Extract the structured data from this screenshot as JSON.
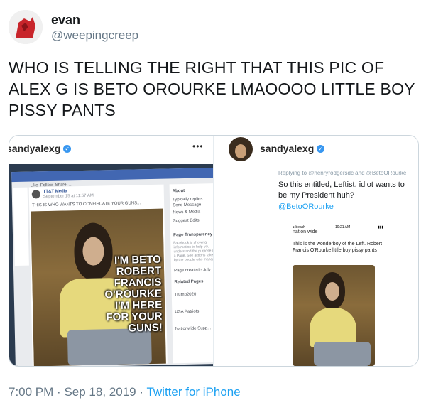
{
  "tweet": {
    "author_name": "evan",
    "author_handle": "@weepingcreep",
    "text_lines": [
      "WHO IS TELLING THE RIGHT THAT THIS PIC OF",
      "ALEX G IS BETO OROURKE LMAOOOO LITTLE BOY",
      "PISSY PANTS"
    ],
    "time": "7:00 PM",
    "separator": "·",
    "date": "Sep 18, 2019",
    "client": "Twitter for iPhone"
  },
  "left_post": {
    "username": "sandyalexg",
    "menu": "•••",
    "fb_actions": [
      "Like",
      "Follow",
      "Share",
      "..."
    ],
    "fb_page_name": "TT&T Media",
    "fb_post_date": "September 15 at 11:57 AM",
    "fb_post_text": "THIS IS WHO WANTS TO CONFISCATE YOUR GUNS...",
    "fb_side": {
      "about": "About",
      "items": [
        "Typically replies",
        "Send Message",
        "News & Media",
        "Suggest Edits"
      ],
      "transparency": "Page Transparency",
      "transparency_text": "Facebook is showing information to help you understand the purpose of a Page. See actions taken by the people who manage",
      "page_created": "Page created - July",
      "related": "Related Pages",
      "related_pages": [
        "Trump2020",
        "USA Patriots",
        "Nationwide Supp..."
      ]
    },
    "overlay_lines": [
      "I'M BETO",
      "ROBERT",
      "FRANCIS",
      "O'ROURKE",
      "I'M HERE",
      "FOR YOUR",
      "GUNS!"
    ]
  },
  "right_post": {
    "username": "sandyalexg",
    "replying_to": "Replying to @henryrodgersdc and @BetoORourke",
    "text": "So this entitled, Leftist, idiot wants to be my President huh?",
    "mention": "@BetoORourke",
    "phone_status": "nation wide",
    "phone_time": "10:21 AM",
    "inner_text": "This is the wonderboy of the Left. Robert Francis O'Rourke little boy pissy pants"
  },
  "colors": {
    "twitter_blue": "#1da1f2",
    "instagram_blue": "#3897f0",
    "facebook_blue": "#4267b2",
    "gray": "#657786"
  },
  "icons": [
    "avatar-image",
    "verified-badge-icon",
    "more-options-icon"
  ]
}
